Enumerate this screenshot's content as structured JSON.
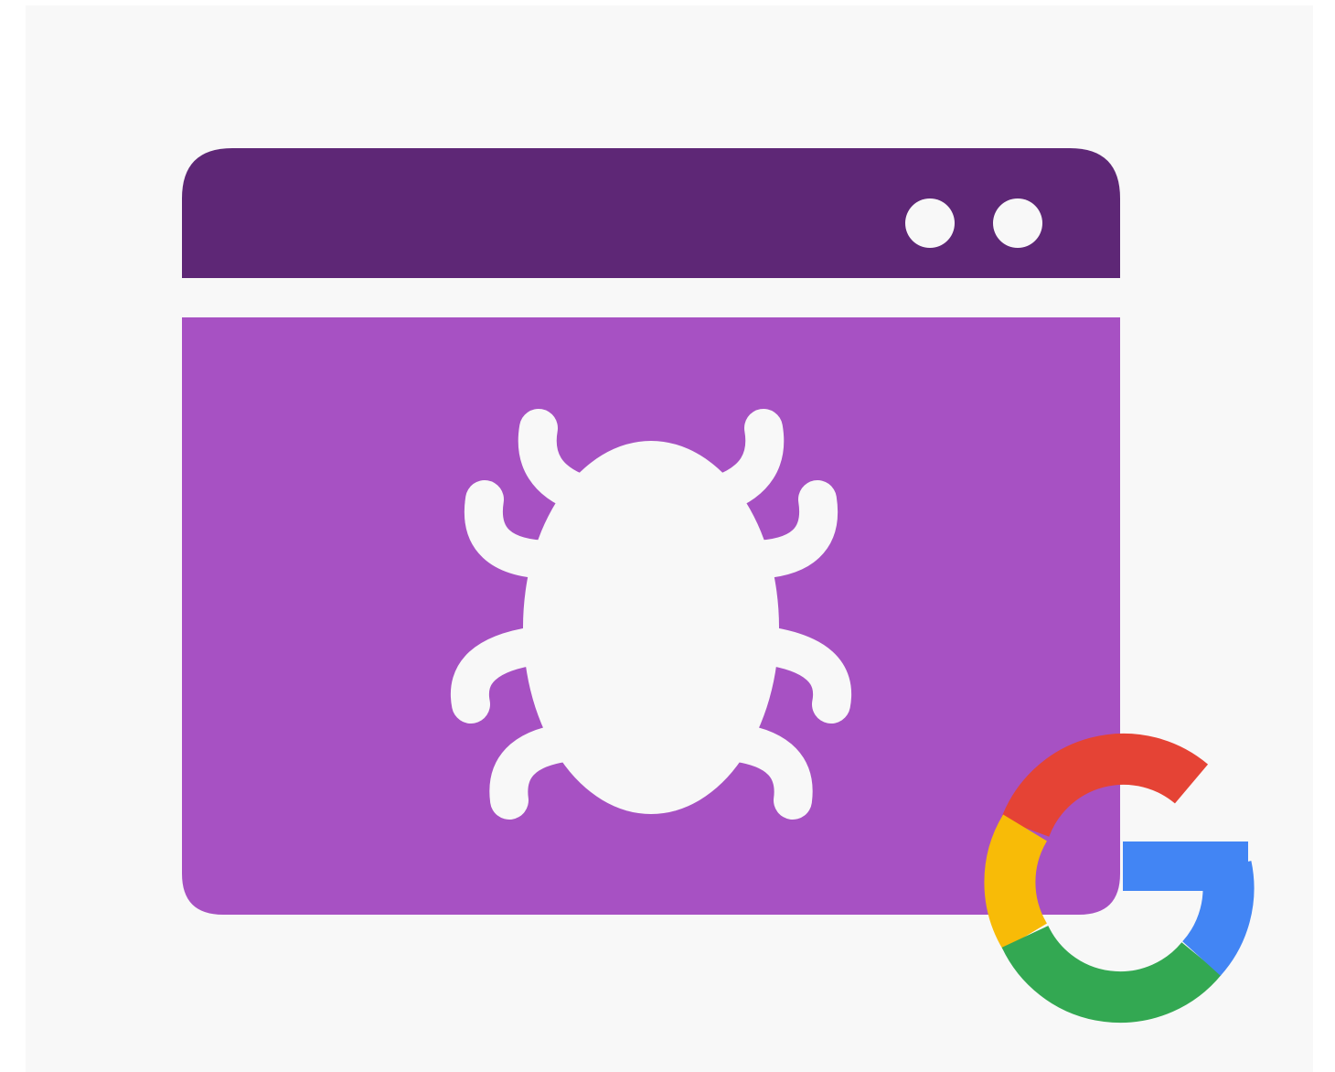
{
  "illustration": {
    "icons": [
      "browser-window-icon",
      "bug-icon",
      "google-g-logo"
    ],
    "colors": {
      "background": "#f8f8f8",
      "title_bar": "#5e2776",
      "window_body": "#a751c3",
      "window_dots": "#f8f8f8",
      "bug": "#f8f8f8",
      "google_red": "#e54335",
      "google_yellow": "#f8bb07",
      "google_green": "#33a852",
      "google_blue": "#4285f4"
    }
  }
}
